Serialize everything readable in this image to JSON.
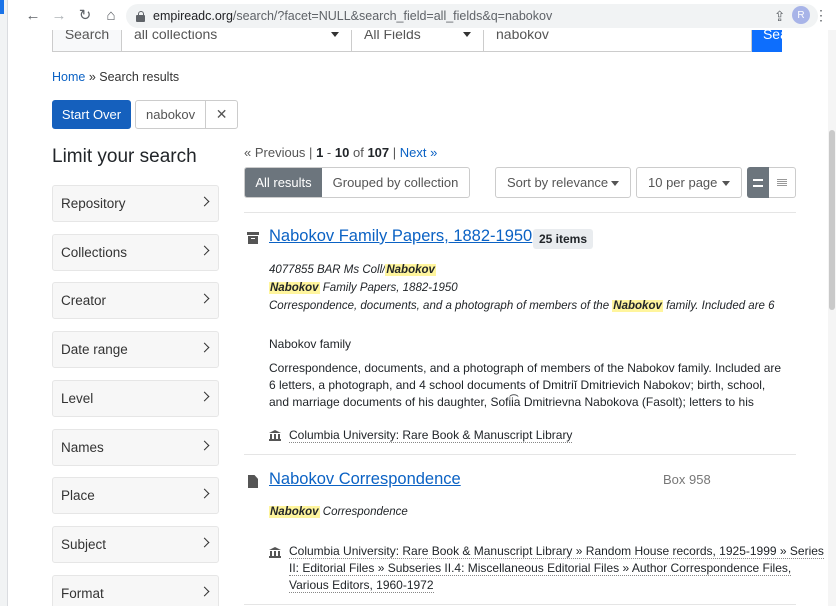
{
  "browser": {
    "url_host": "empireadc.org",
    "url_path": "/search/?facet=NULL&search_field=all_fields&q=nabokov",
    "profile_initial": "R"
  },
  "search": {
    "button_label": "Search",
    "collection_select": "all collections",
    "field_select": "All Fields",
    "query": "nabokov",
    "submit_label": "Search"
  },
  "breadcrumb": {
    "home": "Home",
    "separator": "»",
    "current": "Search results"
  },
  "constraints": {
    "start_over": "Start Over",
    "query_value": "nabokov",
    "remove": "✕"
  },
  "sidebar": {
    "title": "Limit your search",
    "facets": [
      "Repository",
      "Collections",
      "Creator",
      "Date range",
      "Level",
      "Names",
      "Place",
      "Subject",
      "Format"
    ]
  },
  "pager": {
    "previous": "« Previous",
    "divider": "|",
    "range_start": "1",
    "range_sep": "-",
    "range_end": "10",
    "of": "of",
    "total": "107",
    "next": "Next »"
  },
  "view_tabs": {
    "all_results": "All results",
    "grouped": "Grouped by collection"
  },
  "sort": {
    "label": "Sort by relevance"
  },
  "per_page": {
    "label": "10 per page"
  },
  "results": [
    {
      "title": "Nabokov Family Papers, 1882-1950",
      "badge": "25 items",
      "meta1_prefix": "4077855 BAR Ms Coll/",
      "meta1_highlight": "Nabokov",
      "meta2_highlight": "Nabokov",
      "meta2_suffix": " Family Papers, 1882-1950",
      "meta3_prefix": "Correspondence, documents, and a photograph of members of the ",
      "meta3_highlight": "Nabokov",
      "meta3_suffix": " family. Included are 6",
      "creator": "Nabokov family",
      "abstract_line1": "Correspondence, documents, and a photograph of members of the Nabokov family. Included are",
      "abstract_line2": "6 letters, a photograph, and 4 school documents of Dmitriĭ Dmitrievich Nabokov; birth, school,",
      "abstract_line3": "and marriage documents of his daughter, Sofii͡a Dmitrievna Nabokova (Fasolt); letters to his",
      "repository": "Columbia University: Rare Book & Manuscript Library"
    },
    {
      "title": "Nabokov Correspondence",
      "box": "Box 958",
      "meta1_highlight": "Nabokov",
      "meta1_suffix": " Correspondence",
      "repo_line1": "Columbia University: Rare Book & Manuscript Library » Random House records, 1925-1999 » Series",
      "repo_line2": "II: Editorial Files » Subseries II.4: Miscellaneous Editorial Files » Author Correspondence Files,",
      "repo_line3": "Various Editors, 1960-1972"
    }
  ]
}
